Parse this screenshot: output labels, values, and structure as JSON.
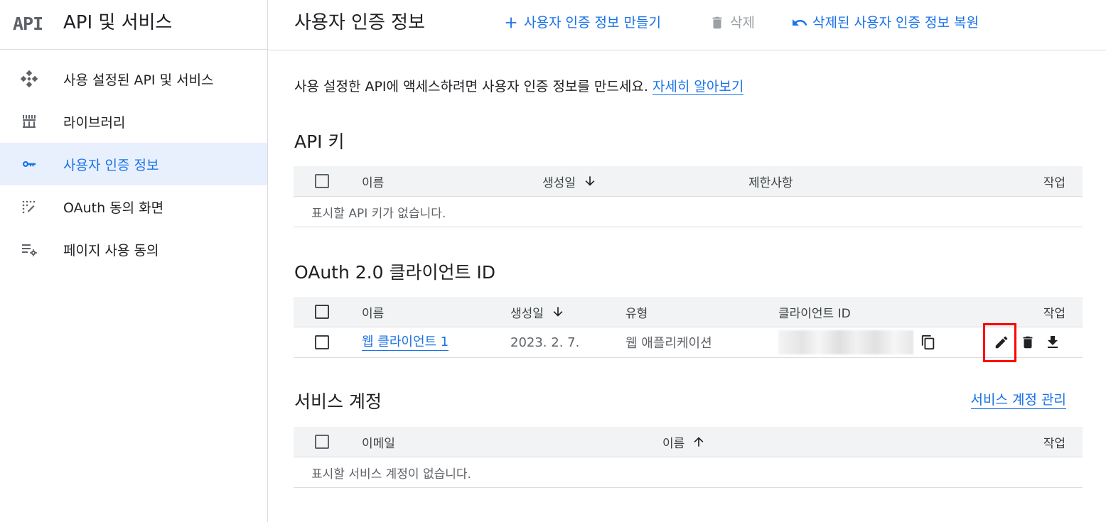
{
  "sidebar": {
    "logo": "API",
    "title": "API 및 서비스",
    "items": [
      {
        "label": "사용 설정된 API 및 서비스",
        "icon": "diamond-grid-icon"
      },
      {
        "label": "라이브러리",
        "icon": "library-icon"
      },
      {
        "label": "사용자 인증 정보",
        "icon": "key-icon",
        "active": true
      },
      {
        "label": "OAuth 동의 화면",
        "icon": "dotted-consent-icon"
      },
      {
        "label": "페이지 사용 동의",
        "icon": "list-settings-icon"
      }
    ]
  },
  "header": {
    "title": "사용자 인증 정보",
    "create_label": "사용자 인증 정보 만들기",
    "delete_label": "삭제",
    "restore_label": "삭제된 사용자 인증 정보 복원"
  },
  "intro": {
    "text": "사용 설정한 API에 액세스하려면 사용자 인증 정보를 만드세요.",
    "link": "자세히 알아보기"
  },
  "api_keys": {
    "title": "API 키",
    "columns": {
      "name": "이름",
      "created": "생성일",
      "restrictions": "제한사항",
      "actions": "작업"
    },
    "empty": "표시할 API 키가 없습니다."
  },
  "oauth": {
    "title": "OAuth 2.0 클라이언트 ID",
    "columns": {
      "name": "이름",
      "created": "생성일",
      "type": "유형",
      "client_id": "클라이언트 ID",
      "actions": "작업"
    },
    "rows": [
      {
        "name": "웹 클라이언트 1",
        "created": "2023. 2. 7.",
        "type": "웹 애플리케이션"
      }
    ]
  },
  "service_accounts": {
    "title": "서비스 계정",
    "manage_link": "서비스 계정 관리",
    "columns": {
      "email": "이메일",
      "name": "이름",
      "actions": "작업"
    },
    "empty": "표시할 서비스 계정이 없습니다."
  },
  "colors": {
    "accent": "#1a73e8",
    "highlight": "#ff0000",
    "active_bg": "#e8f0fe"
  }
}
